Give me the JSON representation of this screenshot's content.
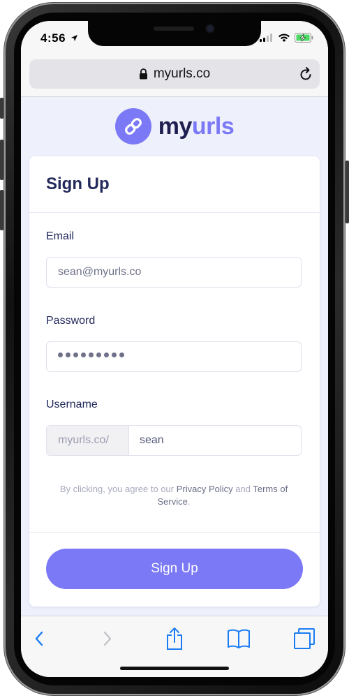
{
  "status_bar": {
    "time": "4:56"
  },
  "browser": {
    "url": "myurls.co"
  },
  "logo": {
    "name_part1": "my",
    "name_part2": "urls"
  },
  "form": {
    "title": "Sign Up",
    "email": {
      "label": "Email",
      "value": "sean@myurls.co"
    },
    "password": {
      "label": "Password",
      "masked_length": 9
    },
    "username": {
      "label": "Username",
      "prefix": "myurls.co/",
      "value": "sean"
    },
    "agreement": {
      "text_before": "By clicking, you agree to our ",
      "privacy_link": "Privacy Policy",
      "text_middle": " and ",
      "terms_link": "Terms of Service",
      "text_after": "."
    },
    "submit_label": "Sign Up"
  },
  "colors": {
    "accent": "#7b79f5",
    "heading": "#232a5c",
    "ios_blue": "#1a7cf5"
  },
  "toolbar": {
    "icons": [
      "back-icon",
      "forward-icon",
      "share-icon",
      "bookmarks-icon",
      "tabs-icon"
    ]
  }
}
